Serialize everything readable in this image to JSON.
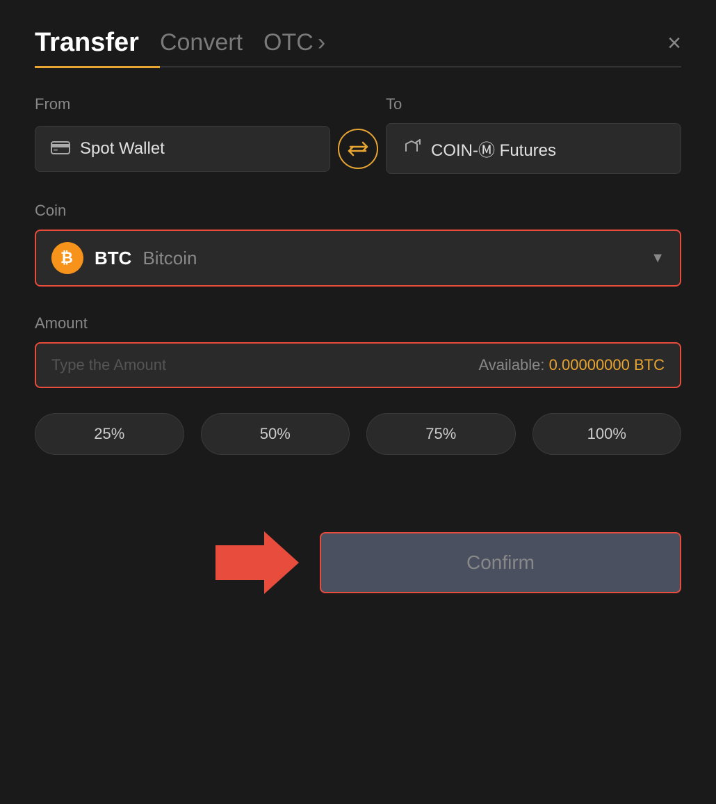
{
  "header": {
    "tab_transfer": "Transfer",
    "tab_convert": "Convert",
    "tab_otc": "OTC",
    "close_label": "×"
  },
  "from_section": {
    "label": "From",
    "wallet_icon": "💳",
    "wallet_name": "Spot Wallet"
  },
  "to_section": {
    "label": "To",
    "wallet_icon": "↑",
    "wallet_name": "COIN-Ⓜ Futures"
  },
  "swap_icon": "⇄",
  "coin_section": {
    "label": "Coin",
    "coin_symbol": "BTC",
    "coin_name": "Bitcoin",
    "btc_letter": "₿"
  },
  "amount_section": {
    "label": "Amount",
    "placeholder": "Type the Amount",
    "available_label": "Available:",
    "available_amount": "0.00000000 BTC"
  },
  "percent_buttons": [
    {
      "label": "25%"
    },
    {
      "label": "50%"
    },
    {
      "label": "75%"
    },
    {
      "label": "100%"
    }
  ],
  "confirm_button": {
    "label": "Confirm"
  },
  "colors": {
    "accent": "#e8a532",
    "red": "#e74c3c",
    "bg": "#1a1a1a"
  }
}
